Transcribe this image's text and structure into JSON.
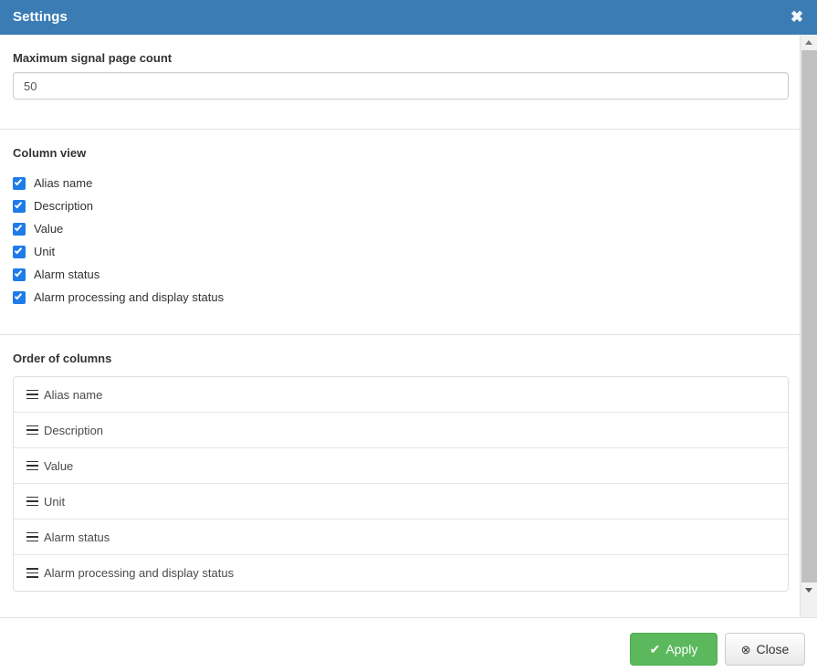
{
  "header": {
    "title": "Settings",
    "close_icon": "close-x-icon",
    "close_label": "✖"
  },
  "page_count_section": {
    "label": "Maximum signal page count",
    "input_value": "50",
    "input_placeholder": ""
  },
  "column_view_section": {
    "label": "Column view",
    "items": [
      {
        "label": "Alias name",
        "checked": true
      },
      {
        "label": "Description",
        "checked": true
      },
      {
        "label": "Value",
        "checked": true
      },
      {
        "label": "Unit",
        "checked": true
      },
      {
        "label": "Alarm status",
        "checked": true
      },
      {
        "label": "Alarm processing and display status",
        "checked": true
      }
    ]
  },
  "order_section": {
    "label": "Order of columns",
    "handle_icon": "drag-handle-icon",
    "items": [
      {
        "label": "Alias name"
      },
      {
        "label": "Description"
      },
      {
        "label": "Value"
      },
      {
        "label": "Unit"
      },
      {
        "label": "Alarm status"
      },
      {
        "label": "Alarm processing and display status"
      }
    ]
  },
  "scrollbar": {
    "up_icon": "scroll-up-arrow-icon",
    "down_icon": "scroll-down-arrow-icon"
  },
  "footer": {
    "apply_label": "Apply",
    "apply_icon": "check-icon",
    "apply_icon_glyph": "✔",
    "close_label": "Close",
    "close_icon": "circle-x-icon",
    "close_icon_glyph": "⊗"
  },
  "colors": {
    "header_blue": "#3b7cb5",
    "apply_green": "#5cb85c",
    "checkbox_blue": "#1e7ce8",
    "border_gray": "#dddddd"
  }
}
